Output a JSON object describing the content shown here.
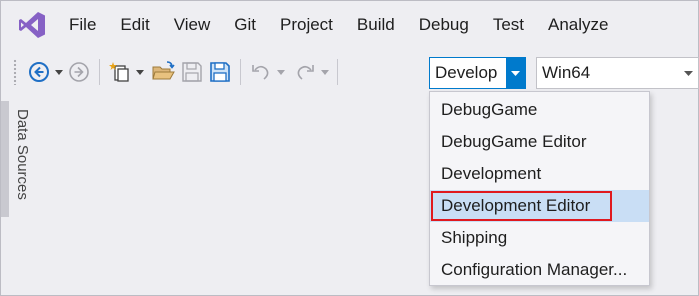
{
  "menu": {
    "items": [
      "File",
      "Edit",
      "View",
      "Git",
      "Project",
      "Build",
      "Debug",
      "Test",
      "Analyze"
    ]
  },
  "toolbar": {
    "icons": [
      "back-icon",
      "forward-icon",
      "new-project-icon",
      "open-folder-icon",
      "save-icon",
      "save-all-icon",
      "undo-icon",
      "redo-icon"
    ],
    "configuration": "Develop",
    "platform": "Win64"
  },
  "dropdown": {
    "items": [
      "DebugGame",
      "DebugGame Editor",
      "Development",
      "Development Editor",
      "Shipping",
      "Configuration Manager..."
    ],
    "selected_index": 3
  },
  "side_panel": {
    "label": "Data Sources"
  },
  "colors": {
    "accent": "#007acc",
    "selection": "#c9def5",
    "highlight_border": "#e0191f",
    "logo": "#8661c5"
  }
}
